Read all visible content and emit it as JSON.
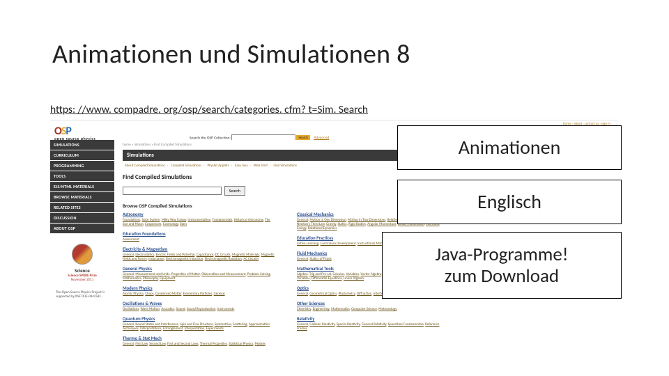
{
  "title": "Animationen und Simulationen 8",
  "url": "https: //www. compadre. org/osp/search/categories. cfm? t=Sim. Search",
  "overlays": {
    "a": "Animationen",
    "b": "Englisch",
    "c": "Java-Programme!\nzum Download"
  },
  "shot": {
    "top_links": "home · about · contact us · sign in",
    "logo_sub": "open source physics",
    "search_label": "Search the OSP Collection:",
    "search_go": "Search",
    "adv": "Advanced",
    "nav": [
      "SIMULATIONS",
      "CURRICULUM",
      "PROGRAMMING",
      "TOOLS",
      "EJS/HTML MATERIALS",
      "BROWSE MATERIALS",
      "RELATED SITES",
      "DISCUSSION",
      "ABOUT OSP"
    ],
    "sponsor_label": "Science",
    "sponsor_prize": "Science SPORE Prize",
    "sponsor_date": "November 2011",
    "sponsor_text": "The Open Source Physics Project is supported by NSF DUE-0442581.",
    "crumbs": "home » Simulations » Find Compiled Simulations",
    "page_head": "Simulations",
    "tabs": [
      "About Compiled Simulations",
      "Compiled Simulations",
      "Physlet Applets",
      "Easy Java",
      "Web Start",
      "Find Simulations"
    ],
    "find_title": "Find Compiled Simulations",
    "find_btn": "Search",
    "browse_title": "Browse OSP Compiled Simulations",
    "left_cats": [
      {
        "h": "Astronomy",
        "d": "Foundations, Solar System, Milky Way Galaxy, Instrumentation, Fundamentals, Historical Astronomy, The Sun and Moon, Cosponsors, Cosmology, Stars"
      },
      {
        "h": "Education Foundations",
        "d": "Assessment"
      },
      {
        "h": "Electricity & Magnetism",
        "d": "General, Electrostatics, Electric Fields and Potential, Capacitance, DC Circuits, Magnetic Materials, Magnetic Fields and Forces, Inductance, Electromagnetic Induction, Electromagnetic Radiation, AC Circuits"
      },
      {
        "h": "General Physics",
        "d": "General, Measurement and Units, Properties of Matter, Observation and Measurement, Problem Solving, Mathematics, Philosophy, Equipment"
      },
      {
        "h": "Modern Physics",
        "d": "Atomic Physics, Chaos, Condensed Matter, Elementary Particles, General"
      },
      {
        "h": "Oscillations & Waves",
        "d": "Oscillations, Wave Motion, Acoustics, Sound, Sound Reproduction, Instruments"
      },
      {
        "h": "Quantum Physics",
        "d": "General, Bound States and Interference, Spin and Fine Structure, Symmetries, Scattering, Approximation Techniques, Interpretations, Entanglement, Interpretation, Experiments"
      },
      {
        "h": "Thermo & Stat Mech",
        "d": "General, First Law, Second Law, First and Second Laws, Thermal Properties, Statistical Physics, Models"
      }
    ],
    "right_cats": [
      {
        "h": "Classical Mechanics",
        "d": "General, Motion in One Dimension, Motion in Two Dimensions, Relative Motion, Newton's Second Law, Newton's Third Law, Gravity, Statics, Rigid Bodies, Angular Momentum, Linear Momentum, Work and Energy, Rotational Dynamics"
      },
      {
        "h": "Education Practices",
        "d": "Active Learning, Curriculum Development, Instructional Material Development, Pedagogy"
      },
      {
        "h": "Fluid Mechanics",
        "d": "General, Statics of Fluids"
      },
      {
        "h": "Mathematical Tools",
        "d": "Algebra, Trig and Pre-cal, Calculus, Variables, Vector Algebra, Series and Functions, Statistics, Complex Variables, Differential Equations, Linear Algebra"
      },
      {
        "h": "Optics",
        "d": "General, Geometrical Optics, Photometry, Diffraction, Interference, Color"
      },
      {
        "h": "Other Sciences",
        "d": "Chemistry, Engineering, Mathematics, Computer Science, Meteorology"
      },
      {
        "h": "Relativity",
        "d": "General, Galilean Relativity, Special Relativity, General Relativity, Spacetime Fundamentals, Reference Frames"
      }
    ]
  }
}
